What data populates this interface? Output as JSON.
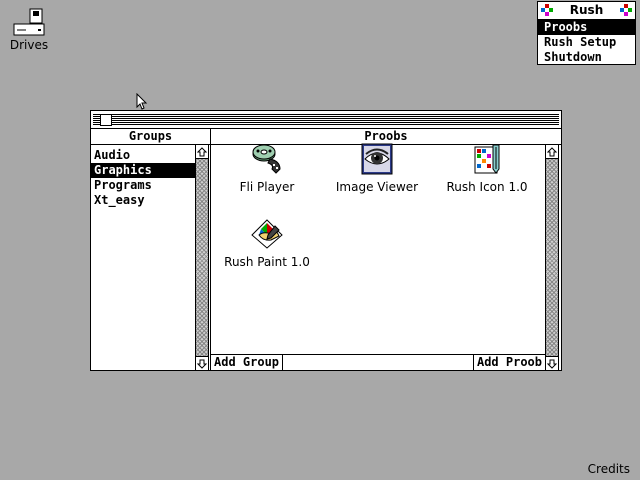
{
  "desktop": {
    "drives_label": "Drives",
    "credits_label": "Credits",
    "background_color": "#a8a8a8"
  },
  "rush_menu": {
    "title": "Rush",
    "items": [
      {
        "label": "Proobs",
        "selected": true
      },
      {
        "label": "Rush Setup",
        "selected": false
      },
      {
        "label": "Shutdown",
        "selected": false
      }
    ]
  },
  "window": {
    "groups_header": "Groups",
    "proobs_header": "Proobs",
    "groups": [
      {
        "label": "Audio",
        "selected": false
      },
      {
        "label": "Graphics",
        "selected": true
      },
      {
        "label": "Programs",
        "selected": false
      },
      {
        "label": "Xt_easy",
        "selected": false
      }
    ],
    "apps": [
      {
        "label": "Fli Player",
        "icon": "film-reel-icon"
      },
      {
        "label": "Image Viewer",
        "icon": "eye-icon"
      },
      {
        "label": "Rush Icon 1.0",
        "icon": "icon-editor-icon"
      },
      {
        "label": "Rush Paint 1.0",
        "icon": "paint-icon"
      }
    ],
    "add_group_label": "Add Group",
    "add_proob_label": "Add Proob"
  }
}
